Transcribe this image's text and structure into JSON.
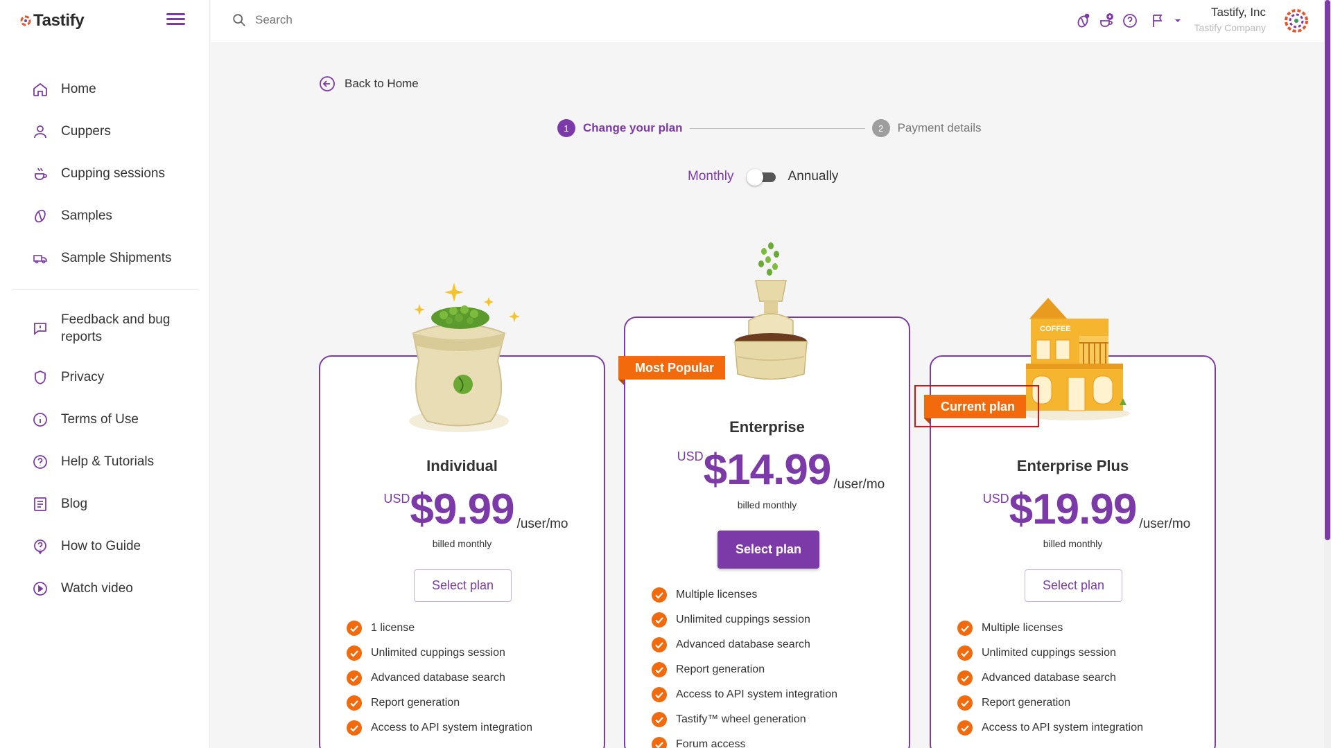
{
  "app": {
    "logo_text": "Tastify",
    "logo_mark": "®"
  },
  "sidebar": {
    "items": [
      {
        "label": "Home",
        "icon": "home-icon"
      },
      {
        "label": "Cuppers",
        "icon": "user-icon"
      },
      {
        "label": "Cupping sessions",
        "icon": "cup-icon"
      },
      {
        "label": "Samples",
        "icon": "bean-icon"
      },
      {
        "label": "Sample Shipments",
        "icon": "truck-icon"
      }
    ],
    "secondary": [
      {
        "label": "Feedback and bug reports",
        "icon": "feedback-icon"
      },
      {
        "label": "Privacy",
        "icon": "shield-icon"
      },
      {
        "label": "Terms of Use",
        "icon": "info-icon"
      },
      {
        "label": "Help & Tutorials",
        "icon": "help-icon"
      },
      {
        "label": "Blog",
        "icon": "document-icon"
      },
      {
        "label": "How to Guide",
        "icon": "guide-icon"
      },
      {
        "label": "Watch video",
        "icon": "play-icon"
      }
    ]
  },
  "topbar": {
    "search_placeholder": "Search",
    "company_name": "Tastify, Inc",
    "company_sub": "Tastify Company"
  },
  "page": {
    "back_label": "Back to Home",
    "steps": [
      {
        "num": "1",
        "label": "Change your plan"
      },
      {
        "num": "2",
        "label": "Payment details"
      }
    ],
    "billing": {
      "monthly": "Monthly",
      "annually": "Annually"
    }
  },
  "plans": [
    {
      "name": "Individual",
      "currency": "USD",
      "price": "$9.99",
      "per": "/user/mo",
      "billed": "billed monthly",
      "button": "Select plan",
      "features": [
        "1 license",
        "Unlimited cuppings session",
        "Advanced database search",
        "Report generation",
        "Access to API system integration"
      ]
    },
    {
      "name": "Enterprise",
      "badge": "Most Popular",
      "currency": "USD",
      "price": "$14.99",
      "per": "/user/mo",
      "billed": "billed monthly",
      "button": "Select plan",
      "features": [
        "Multiple licenses",
        "Unlimited cuppings session",
        "Advanced database search",
        "Report generation",
        "Access to API system integration",
        "Tastify™ wheel generation",
        "Forum access"
      ]
    },
    {
      "name": "Enterprise Plus",
      "badge": "Current plan",
      "building_sign": "COFFEE",
      "currency": "USD",
      "price": "$19.99",
      "per": "/user/mo",
      "billed": "billed monthly",
      "button": "Select plan",
      "features": [
        "Multiple licenses",
        "Unlimited cuppings session",
        "Advanced database search",
        "Report generation",
        "Access to API system integration"
      ]
    }
  ],
  "colors": {
    "brand": "#7c3aa8",
    "accent": "#f26a0c",
    "highlight": "#e01010"
  }
}
